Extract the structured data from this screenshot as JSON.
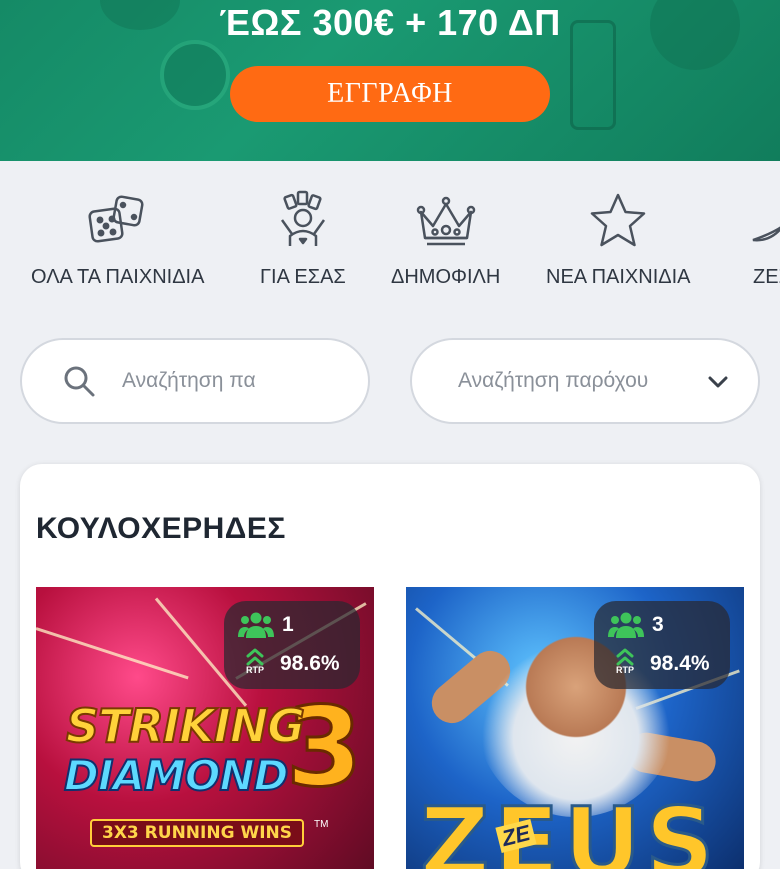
{
  "banner": {
    "title": "ΈΩΣ 300€ + 170 ΔΠ",
    "cta_label": "ΕΓΓΡΑΦΗ",
    "accent": "#ff6a13"
  },
  "categories": [
    {
      "label": "ΟΛΑ ΤΑ ΠΑΙΧΝΙΔΙΑ",
      "icon": "dice-icon"
    },
    {
      "label": "ΓΙΑ ΕΣΑΣ",
      "icon": "user-cards-icon"
    },
    {
      "label": "ΔΗΜΟΦΙΛΗ",
      "icon": "crown-icon"
    },
    {
      "label": "ΝΕΑ ΠΑΙΧΝΙΔΙΑ",
      "icon": "star-icon"
    },
    {
      "label": "ΖΕΣ",
      "icon": "moon-icon"
    }
  ],
  "search": {
    "game_placeholder": "Αναζήτηση πα",
    "provider_placeholder": "Αναζήτηση παρόχου"
  },
  "section": {
    "title": "ΚΟΥΛΟΧΕΡΗΔΕΣ",
    "games": [
      {
        "players": "1",
        "rtp_tag": "RTP",
        "rtp": "98.6%",
        "art_line1": "STRIKING",
        "art_line2": "DIAMOND",
        "art_number": "3",
        "art_sub": "3X3 RUNNING WINS",
        "art_tm": "TM"
      },
      {
        "players": "3",
        "rtp_tag": "RTP",
        "rtp": "98.4%",
        "art_title": "ZEUS",
        "art_small": "ZE"
      }
    ]
  }
}
